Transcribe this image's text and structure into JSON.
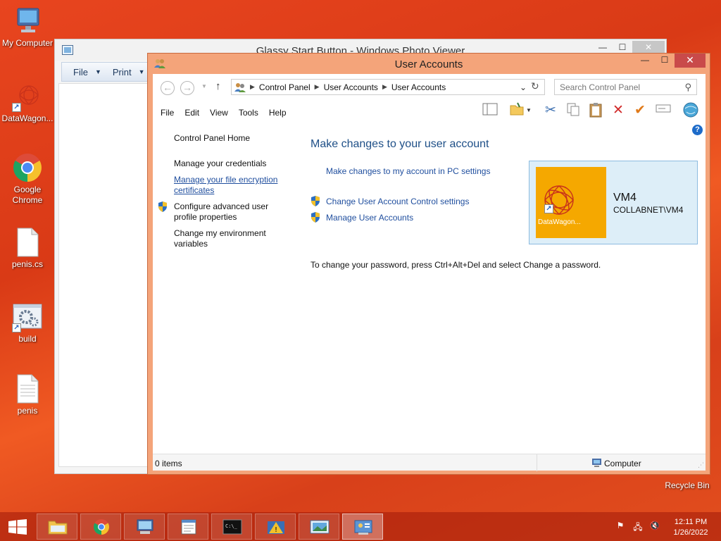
{
  "desktop": {
    "icons": [
      {
        "label": "My Computer"
      },
      {
        "label": "DataWagon..."
      },
      {
        "label": "Google Chrome"
      },
      {
        "label": "penis.cs"
      },
      {
        "label": "build"
      },
      {
        "label": "penis"
      }
    ],
    "recycle_bin": "Recycle Bin"
  },
  "photo_viewer": {
    "title": "Glassy Start Button - Windows Photo Viewer",
    "menu": {
      "file": "File",
      "print": "Print"
    }
  },
  "user_accounts": {
    "title": "User Accounts",
    "breadcrumb": [
      "Control Panel",
      "User Accounts",
      "User Accounts"
    ],
    "search_placeholder": "Search Control Panel",
    "menu": [
      "File",
      "Edit",
      "View",
      "Tools",
      "Help"
    ],
    "left_pane": {
      "home": "Control Panel Home",
      "credentials": "Manage your credentials",
      "encryption_line1": "Manage your file encryption",
      "encryption_line2": "certificates",
      "advanced_line1": "Configure advanced user",
      "advanced_line2": "profile properties",
      "env_line1": "Change my environment",
      "env_line2": "variables"
    },
    "main": {
      "heading": "Make changes to your user account",
      "pc_settings_link": "Make changes to my account in PC settings",
      "uac_link": "Change User Account Control settings",
      "manage_link": "Manage User Accounts",
      "password_text": "To change your password, press Ctrl+Alt+Del and select Change a password."
    },
    "account": {
      "name": "VM4",
      "domain": "COLLABNET\\VM4",
      "picture_label": "DataWagon..."
    },
    "status": {
      "items": "0 items",
      "location": "Computer"
    }
  },
  "taskbar": {
    "apps": [
      "file-explorer",
      "chrome",
      "remote-desktop",
      "notepad",
      "command-prompt",
      "action-center",
      "photo-viewer",
      "control-panel"
    ],
    "time": "12:11 PM",
    "date": "1/26/2022"
  },
  "colors": {
    "desktop": "#e24e1e",
    "window_frame": "#f4a47a",
    "link": "#1f4e9e",
    "heading": "#1e4f87",
    "close_button": "#c94a4a"
  }
}
